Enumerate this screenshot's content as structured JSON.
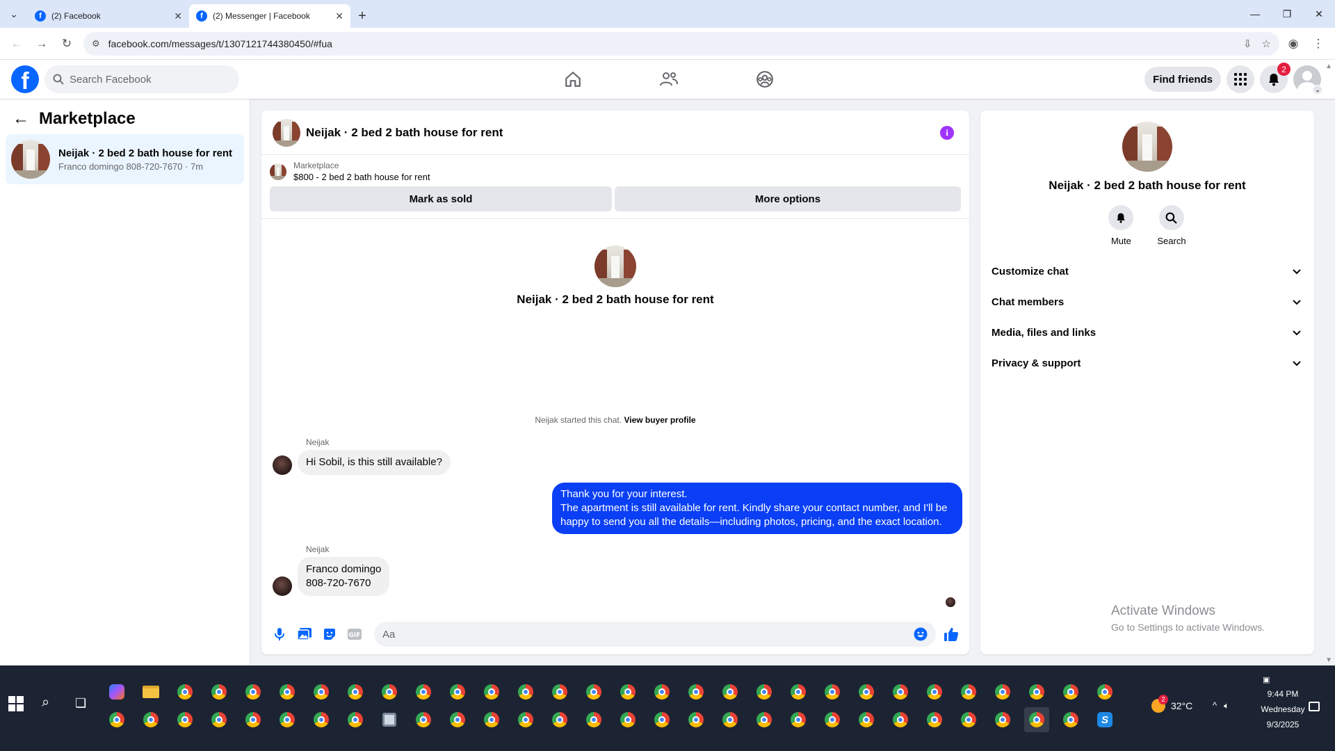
{
  "browser": {
    "tabs": [
      {
        "title": "(2) Facebook",
        "active": false
      },
      {
        "title": "(2) Messenger | Facebook",
        "active": true
      }
    ],
    "url": "facebook.com/messages/t/1307121744380450/#fua"
  },
  "header": {
    "search_placeholder": "Search Facebook",
    "find_friends_label": "Find friends",
    "notification_count": "2"
  },
  "sidebar": {
    "title": "Marketplace",
    "conversations": [
      {
        "name": "Neijak · 2 bed 2 bath house for rent",
        "preview": "Franco domingo 808-720-7670 · 7m"
      }
    ]
  },
  "chat": {
    "title": "Neijak · 2 bed 2 bath house for rent",
    "listing": {
      "label": "Marketplace",
      "price_title": "$800 - 2 bed 2 bath house for rent",
      "mark_sold_label": "Mark as sold",
      "more_options_label": "More options"
    },
    "intro_title": "Neijak · 2 bed 2 bath house for rent",
    "system_note": "Neijak started this chat.",
    "system_link": "View buyer profile",
    "messages": [
      {
        "sender": "Neijak",
        "direction": "in",
        "text": "Hi Sobil, is this still available?"
      },
      {
        "direction": "out",
        "lines": [
          "Thank you for your interest.",
          "The apartment is still available for rent. Kindly share your contact number, and I'll be happy to send you all the details—including photos, pricing, and the exact location."
        ]
      },
      {
        "sender": "Neijak",
        "direction": "in",
        "lines": [
          "Franco domingo",
          "808-720-7670"
        ]
      }
    ],
    "composer_placeholder": "Aa"
  },
  "info_panel": {
    "title": "Neijak · 2 bed 2 bath house for rent",
    "actions": [
      {
        "label": "Mute",
        "icon": "bell-icon"
      },
      {
        "label": "Search",
        "icon": "search-icon"
      }
    ],
    "sections": [
      {
        "label": "Customize chat"
      },
      {
        "label": "Chat members"
      },
      {
        "label": "Media, files and links"
      },
      {
        "label": "Privacy & support"
      }
    ]
  },
  "watermark": {
    "line1": "Activate Windows",
    "line2": "Go to Settings to activate Windows."
  },
  "taskbar": {
    "weather": "32°C",
    "weather_badge": "2",
    "time": "9:44 PM",
    "day": "Wednesday",
    "date": "9/3/2025"
  },
  "colors": {
    "fb_blue": "#0866ff",
    "outgoing_bubble": "#0a3ff5",
    "info_purple": "#a033ff",
    "badge_red": "#e41e3f"
  }
}
